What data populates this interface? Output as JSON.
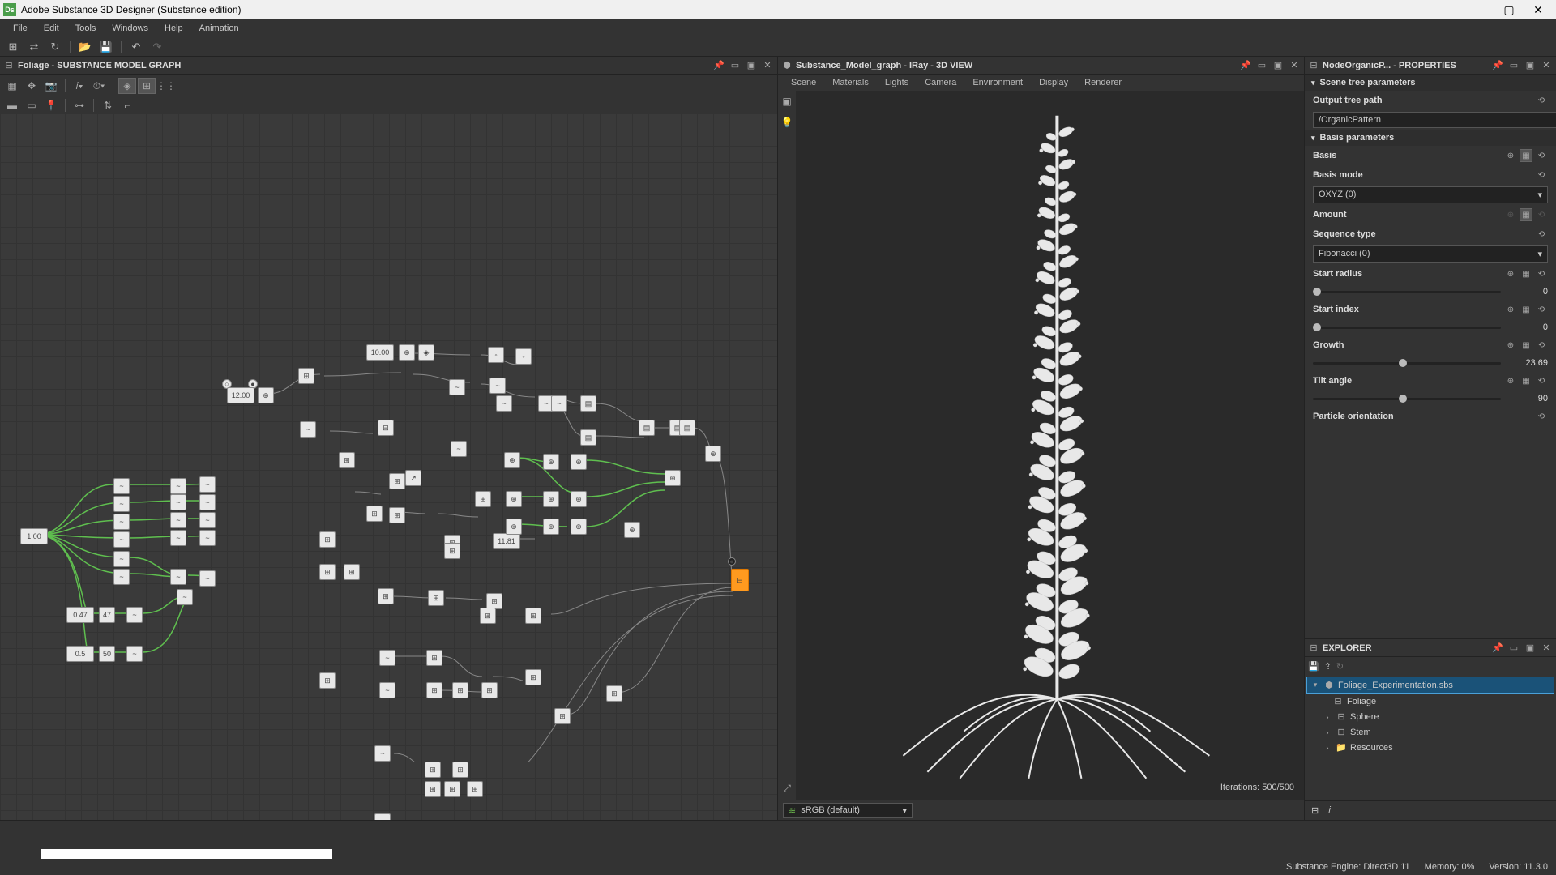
{
  "app": {
    "title": "Adobe Substance 3D Designer (Substance edition)",
    "icon_label": "Ds"
  },
  "menubar": [
    "File",
    "Edit",
    "Tools",
    "Windows",
    "Help",
    "Animation"
  ],
  "graph_panel": {
    "title": "Foliage - SUBSTANCE MODEL GRAPH",
    "node_labels": {
      "a": "1.00",
      "b": "10.00",
      "c": "12.00",
      "d": "0.47",
      "e": "47",
      "f": "0.5",
      "g": "50",
      "h": "11.81"
    }
  },
  "viewport_panel": {
    "title": "Substance_Model_graph - IRay - 3D VIEW",
    "menus": [
      "Scene",
      "Materials",
      "Lights",
      "Camera",
      "Environment",
      "Display",
      "Renderer"
    ],
    "iterations": "Iterations: 500/500",
    "color_profile": "sRGB (default)"
  },
  "properties_panel": {
    "title": "NodeOrganicP... - PROPERTIES",
    "sections": {
      "scene_tree": {
        "header": "Scene tree parameters",
        "output_label": "Output tree path",
        "output_value": "/OrganicPattern"
      },
      "basis": {
        "header": "Basis parameters",
        "basis_label": "Basis",
        "basis_mode_label": "Basis mode",
        "basis_mode_value": "OXYZ (0)",
        "amount_label": "Amount",
        "sequence_label": "Sequence type",
        "sequence_value": "Fibonacci (0)",
        "start_radius_label": "Start radius",
        "start_radius_value": "0",
        "start_index_label": "Start index",
        "start_index_value": "0",
        "growth_label": "Growth",
        "growth_value": "23.69",
        "tilt_label": "Tilt angle",
        "tilt_value": "90",
        "particle_orient_label": "Particle orientation"
      }
    }
  },
  "explorer_panel": {
    "title": "EXPLORER",
    "tree": {
      "root": "Foliage_Experimentation.sbs",
      "children": [
        "Foliage",
        "Sphere",
        "Stem",
        "Resources"
      ]
    }
  },
  "statusbar": {
    "engine": "Substance Engine: Direct3D 11",
    "memory": "Memory: 0%",
    "version": "Version: 11.3.0"
  }
}
